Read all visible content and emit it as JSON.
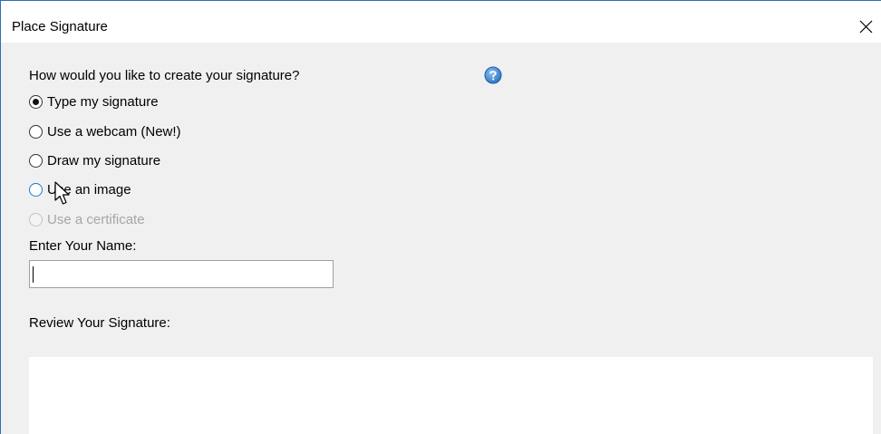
{
  "window": {
    "title": "Place Signature",
    "close_icon": "close-icon"
  },
  "form": {
    "question": "How would you like to create your signature?",
    "help_icon": "help-icon",
    "options": [
      {
        "label": "Type my signature",
        "checked": true,
        "enabled": true
      },
      {
        "label": "Use a webcam (New!)",
        "checked": false,
        "enabled": true
      },
      {
        "label": "Draw my signature",
        "checked": false,
        "enabled": true
      },
      {
        "label": "Use an image",
        "checked": false,
        "enabled": true
      },
      {
        "label": "Use a certificate",
        "checked": false,
        "enabled": false
      }
    ],
    "name_label": "Enter Your Name:",
    "name_value": "",
    "review_label": "Review Your Signature:"
  },
  "colors": {
    "accent": "#1a7ad4",
    "window_border": "#2f6fb6",
    "dialog_background": "#f0f0f0",
    "disabled_text": "#a6a6a6"
  }
}
